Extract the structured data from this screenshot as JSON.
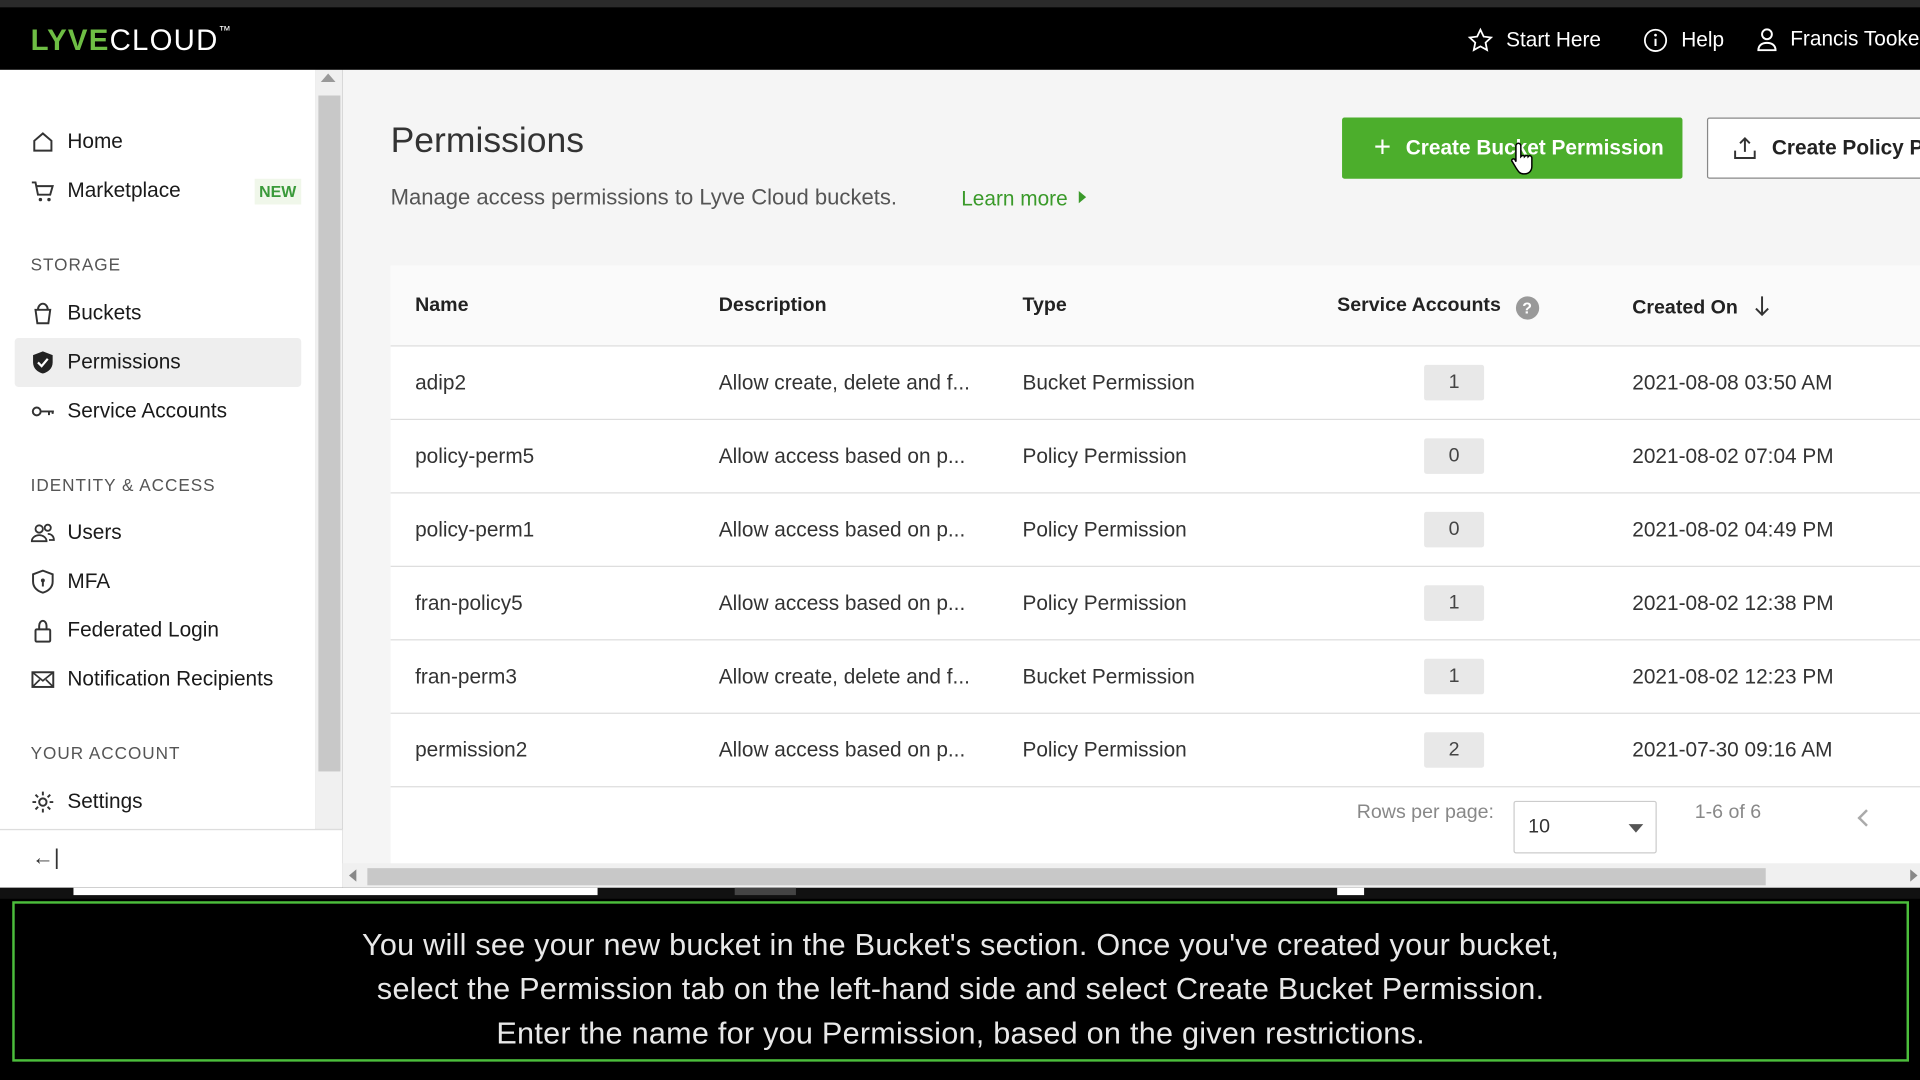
{
  "topbar": {
    "logo_main": "LYVE",
    "logo_sub": "CLOUD",
    "logo_tm": "™",
    "start_here": "Start Here",
    "help": "Help",
    "user": "Francis Tooke"
  },
  "sidebar": {
    "home": "Home",
    "marketplace": "Marketplace",
    "marketplace_badge": "NEW",
    "section_storage": "STORAGE",
    "buckets": "Buckets",
    "permissions": "Permissions",
    "service_accounts": "Service Accounts",
    "section_identity": "IDENTITY & ACCESS",
    "users": "Users",
    "mfa": "MFA",
    "federated_login": "Federated Login",
    "notification_recipients": "Notification Recipients",
    "section_account": "YOUR ACCOUNT",
    "settings": "Settings",
    "collapse": "←|"
  },
  "main": {
    "title": "Permissions",
    "subtitle": "Manage access permissions to Lyve Cloud buckets.",
    "learn_more": "Learn more",
    "create_bucket_permission": "Create Bucket Permission",
    "create_policy_permission": "Create Policy Permission"
  },
  "table": {
    "headers": {
      "name": "Name",
      "description": "Description",
      "type": "Type",
      "service_accounts": "Service Accounts",
      "created_on": "Created On"
    },
    "rows": [
      {
        "name": "adip2",
        "description": "Allow create, delete and f...",
        "type": "Bucket Permission",
        "count": "1",
        "created": "2021-08-08 03:50 AM"
      },
      {
        "name": "policy-perm5",
        "description": "Allow access based on p...",
        "type": "Policy Permission",
        "count": "0",
        "created": "2021-08-02 07:04 PM"
      },
      {
        "name": "policy-perm1",
        "description": "Allow access based on p...",
        "type": "Policy Permission",
        "count": "0",
        "created": "2021-08-02 04:49 PM"
      },
      {
        "name": "fran-policy5",
        "description": "Allow access based on p...",
        "type": "Policy Permission",
        "count": "1",
        "created": "2021-08-02 12:38 PM"
      },
      {
        "name": "fran-perm3",
        "description": "Allow create, delete and f...",
        "type": "Bucket Permission",
        "count": "1",
        "created": "2021-08-02 12:23 PM"
      },
      {
        "name": "permission2",
        "description": "Allow access based on p...",
        "type": "Policy Permission",
        "count": "2",
        "created": "2021-07-30 09:16 AM"
      }
    ],
    "rows_per_page_label": "Rows per page:",
    "rows_per_page_value": "10",
    "range": "1-6 of 6"
  },
  "caption": {
    "line1": "You will see your new bucket in the Bucket's section. Once you've created your bucket,",
    "line2": "select the Permission tab on the left-hand side and select Create Bucket Permission.",
    "line3": "Enter the name for you Permission, based on the given restrictions."
  },
  "colors": {
    "brand_green": "#4cae2c",
    "caption_border": "#4cbe3c"
  }
}
